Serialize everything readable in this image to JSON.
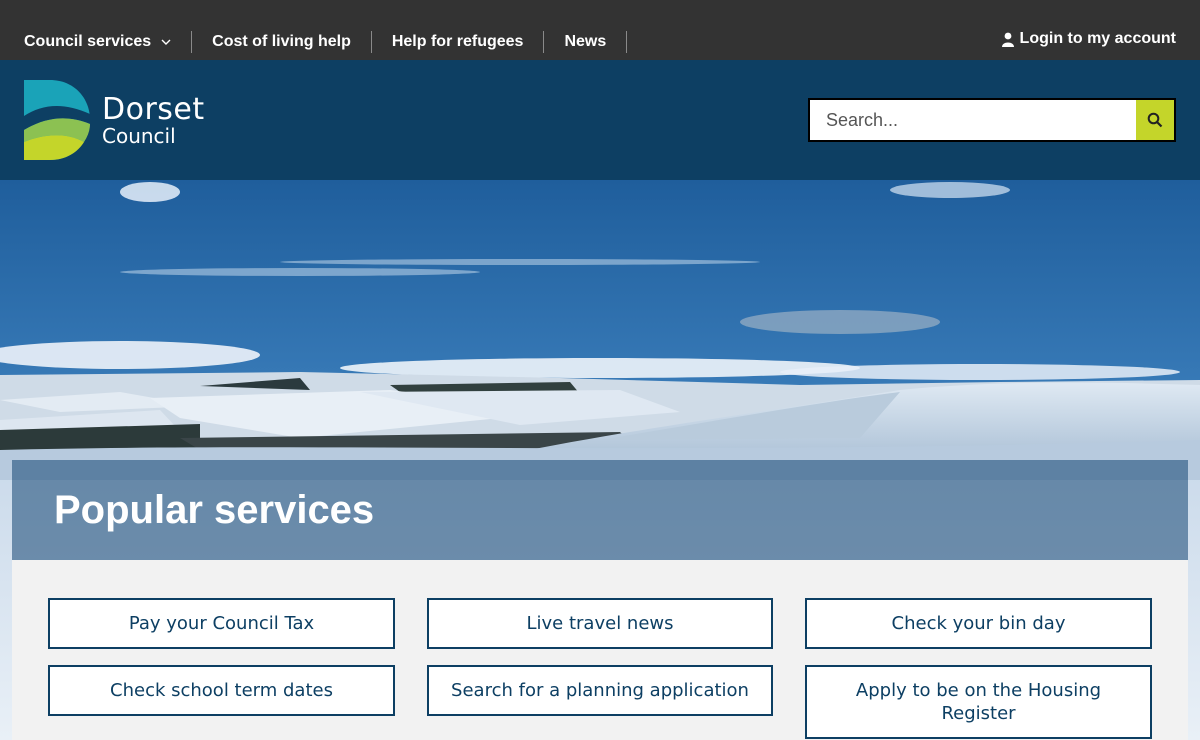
{
  "topbar": {
    "nav": [
      {
        "label": "Council services",
        "has_dropdown": true
      },
      {
        "label": "Cost of living help"
      },
      {
        "label": "Help for refugees"
      },
      {
        "label": "News"
      }
    ],
    "login_label": "Login to my account"
  },
  "header": {
    "logo": {
      "line1": "Dorset",
      "line2": "Council"
    },
    "search": {
      "placeholder": "Search..."
    }
  },
  "hero": {
    "popular_title": "Popular services"
  },
  "services": [
    {
      "label": "Pay your Council Tax"
    },
    {
      "label": "Live travel news"
    },
    {
      "label": "Check your bin day"
    },
    {
      "label": "Check school term dates"
    },
    {
      "label": "Search for a planning application"
    },
    {
      "label": "Apply to be on the Housing Register"
    }
  ],
  "colors": {
    "topbar": "#333333",
    "header": "#0d3f63",
    "accent": "#c4d52a",
    "button_border": "#0d3f63"
  }
}
